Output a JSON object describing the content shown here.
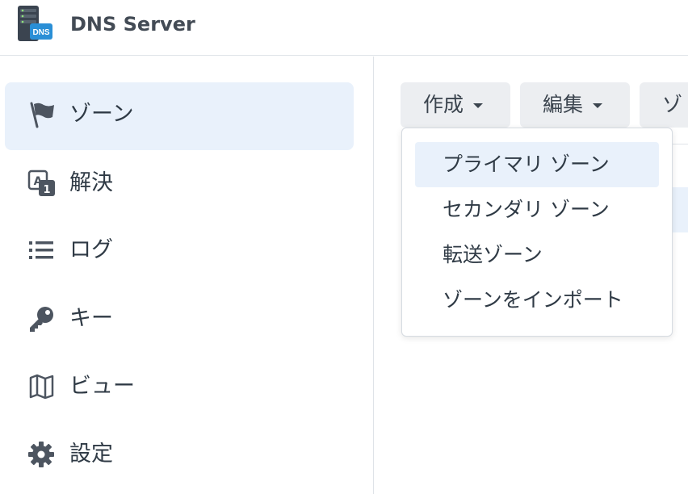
{
  "app": {
    "title": "DNS Server",
    "icon_label": "DNS",
    "icon": "dns-server-icon"
  },
  "sidebar": {
    "items": [
      {
        "label": "ゾーン",
        "icon": "flag-icon",
        "active": true
      },
      {
        "label": "解決",
        "icon": "resolve-icon",
        "active": false
      },
      {
        "label": "ログ",
        "icon": "list-icon",
        "active": false
      },
      {
        "label": "キー",
        "icon": "key-icon",
        "active": false
      },
      {
        "label": "ビュー",
        "icon": "map-icon",
        "active": false
      },
      {
        "label": "設定",
        "icon": "gear-icon",
        "active": false
      }
    ]
  },
  "toolbar": {
    "create_label": "作成",
    "edit_label": "編集",
    "partial_label": "ゾ"
  },
  "create_menu": {
    "items": [
      {
        "label": "プライマリ ゾーン",
        "highlighted": true
      },
      {
        "label": "セカンダリ ゾーン",
        "highlighted": false
      },
      {
        "label": "転送ゾーン",
        "highlighted": false
      },
      {
        "label": "ゾーンをインポート",
        "highlighted": false
      }
    ]
  },
  "colors": {
    "accent_bg": "#e9f1fb",
    "button_bg": "#eceef1",
    "text": "#2f3a45",
    "border": "#dfe3e8"
  }
}
